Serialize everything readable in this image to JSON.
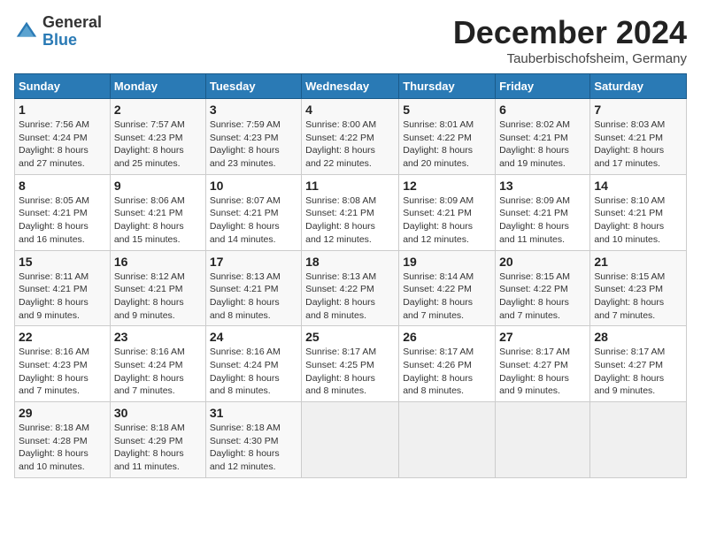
{
  "logo": {
    "general": "General",
    "blue": "Blue"
  },
  "title": "December 2024",
  "location": "Tauberbischofsheim, Germany",
  "days_of_week": [
    "Sunday",
    "Monday",
    "Tuesday",
    "Wednesday",
    "Thursday",
    "Friday",
    "Saturday"
  ],
  "weeks": [
    [
      {
        "day": "1",
        "info": "Sunrise: 7:56 AM\nSunset: 4:24 PM\nDaylight: 8 hours\nand 27 minutes."
      },
      {
        "day": "2",
        "info": "Sunrise: 7:57 AM\nSunset: 4:23 PM\nDaylight: 8 hours\nand 25 minutes."
      },
      {
        "day": "3",
        "info": "Sunrise: 7:59 AM\nSunset: 4:23 PM\nDaylight: 8 hours\nand 23 minutes."
      },
      {
        "day": "4",
        "info": "Sunrise: 8:00 AM\nSunset: 4:22 PM\nDaylight: 8 hours\nand 22 minutes."
      },
      {
        "day": "5",
        "info": "Sunrise: 8:01 AM\nSunset: 4:22 PM\nDaylight: 8 hours\nand 20 minutes."
      },
      {
        "day": "6",
        "info": "Sunrise: 8:02 AM\nSunset: 4:21 PM\nDaylight: 8 hours\nand 19 minutes."
      },
      {
        "day": "7",
        "info": "Sunrise: 8:03 AM\nSunset: 4:21 PM\nDaylight: 8 hours\nand 17 minutes."
      }
    ],
    [
      {
        "day": "8",
        "info": "Sunrise: 8:05 AM\nSunset: 4:21 PM\nDaylight: 8 hours\nand 16 minutes."
      },
      {
        "day": "9",
        "info": "Sunrise: 8:06 AM\nSunset: 4:21 PM\nDaylight: 8 hours\nand 15 minutes."
      },
      {
        "day": "10",
        "info": "Sunrise: 8:07 AM\nSunset: 4:21 PM\nDaylight: 8 hours\nand 14 minutes."
      },
      {
        "day": "11",
        "info": "Sunrise: 8:08 AM\nSunset: 4:21 PM\nDaylight: 8 hours\nand 12 minutes."
      },
      {
        "day": "12",
        "info": "Sunrise: 8:09 AM\nSunset: 4:21 PM\nDaylight: 8 hours\nand 12 minutes."
      },
      {
        "day": "13",
        "info": "Sunrise: 8:09 AM\nSunset: 4:21 PM\nDaylight: 8 hours\nand 11 minutes."
      },
      {
        "day": "14",
        "info": "Sunrise: 8:10 AM\nSunset: 4:21 PM\nDaylight: 8 hours\nand 10 minutes."
      }
    ],
    [
      {
        "day": "15",
        "info": "Sunrise: 8:11 AM\nSunset: 4:21 PM\nDaylight: 8 hours\nand 9 minutes."
      },
      {
        "day": "16",
        "info": "Sunrise: 8:12 AM\nSunset: 4:21 PM\nDaylight: 8 hours\nand 9 minutes."
      },
      {
        "day": "17",
        "info": "Sunrise: 8:13 AM\nSunset: 4:21 PM\nDaylight: 8 hours\nand 8 minutes."
      },
      {
        "day": "18",
        "info": "Sunrise: 8:13 AM\nSunset: 4:22 PM\nDaylight: 8 hours\nand 8 minutes."
      },
      {
        "day": "19",
        "info": "Sunrise: 8:14 AM\nSunset: 4:22 PM\nDaylight: 8 hours\nand 7 minutes."
      },
      {
        "day": "20",
        "info": "Sunrise: 8:15 AM\nSunset: 4:22 PM\nDaylight: 8 hours\nand 7 minutes."
      },
      {
        "day": "21",
        "info": "Sunrise: 8:15 AM\nSunset: 4:23 PM\nDaylight: 8 hours\nand 7 minutes."
      }
    ],
    [
      {
        "day": "22",
        "info": "Sunrise: 8:16 AM\nSunset: 4:23 PM\nDaylight: 8 hours\nand 7 minutes."
      },
      {
        "day": "23",
        "info": "Sunrise: 8:16 AM\nSunset: 4:24 PM\nDaylight: 8 hours\nand 7 minutes."
      },
      {
        "day": "24",
        "info": "Sunrise: 8:16 AM\nSunset: 4:24 PM\nDaylight: 8 hours\nand 8 minutes."
      },
      {
        "day": "25",
        "info": "Sunrise: 8:17 AM\nSunset: 4:25 PM\nDaylight: 8 hours\nand 8 minutes."
      },
      {
        "day": "26",
        "info": "Sunrise: 8:17 AM\nSunset: 4:26 PM\nDaylight: 8 hours\nand 8 minutes."
      },
      {
        "day": "27",
        "info": "Sunrise: 8:17 AM\nSunset: 4:27 PM\nDaylight: 8 hours\nand 9 minutes."
      },
      {
        "day": "28",
        "info": "Sunrise: 8:17 AM\nSunset: 4:27 PM\nDaylight: 8 hours\nand 9 minutes."
      }
    ],
    [
      {
        "day": "29",
        "info": "Sunrise: 8:18 AM\nSunset: 4:28 PM\nDaylight: 8 hours\nand 10 minutes."
      },
      {
        "day": "30",
        "info": "Sunrise: 8:18 AM\nSunset: 4:29 PM\nDaylight: 8 hours\nand 11 minutes."
      },
      {
        "day": "31",
        "info": "Sunrise: 8:18 AM\nSunset: 4:30 PM\nDaylight: 8 hours\nand 12 minutes."
      },
      {
        "day": "",
        "info": ""
      },
      {
        "day": "",
        "info": ""
      },
      {
        "day": "",
        "info": ""
      },
      {
        "day": "",
        "info": ""
      }
    ]
  ]
}
